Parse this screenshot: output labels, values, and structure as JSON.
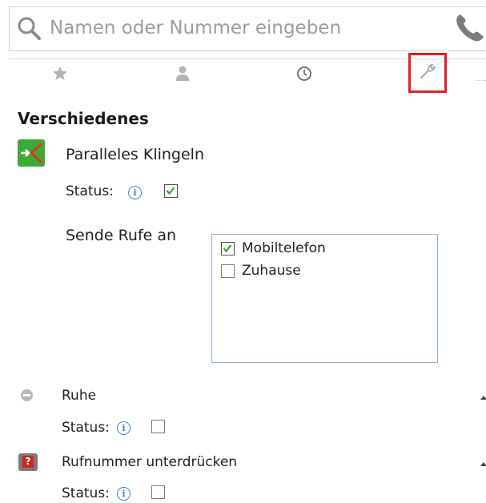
{
  "search": {
    "placeholder": "Namen oder Nummer eingeben"
  },
  "tabs": [
    {
      "icon": "star-icon"
    },
    {
      "icon": "person-icon"
    },
    {
      "icon": "clock-icon"
    },
    {
      "icon": "wrench-icon",
      "active": true
    }
  ],
  "section_title": "Verschiedenes",
  "parallel_ringing": {
    "title": "Paralleles Klingeln",
    "status_label": "Status:",
    "status_checked": true,
    "send_label": "Sende Rufe an",
    "targets": [
      {
        "label": "Mobiltelefon",
        "checked": true
      },
      {
        "label": "Zuhause",
        "checked": false
      }
    ]
  },
  "ruhe": {
    "title": "Ruhe",
    "status_label": "Status:",
    "status_checked": false
  },
  "suppress": {
    "title": "Rufnummer unterdrücken",
    "status_label": "Status:",
    "status_checked": false
  },
  "colors": {
    "accent_red": "#e31f26",
    "green": "#3daa35",
    "info_blue": "#3a86d6"
  }
}
